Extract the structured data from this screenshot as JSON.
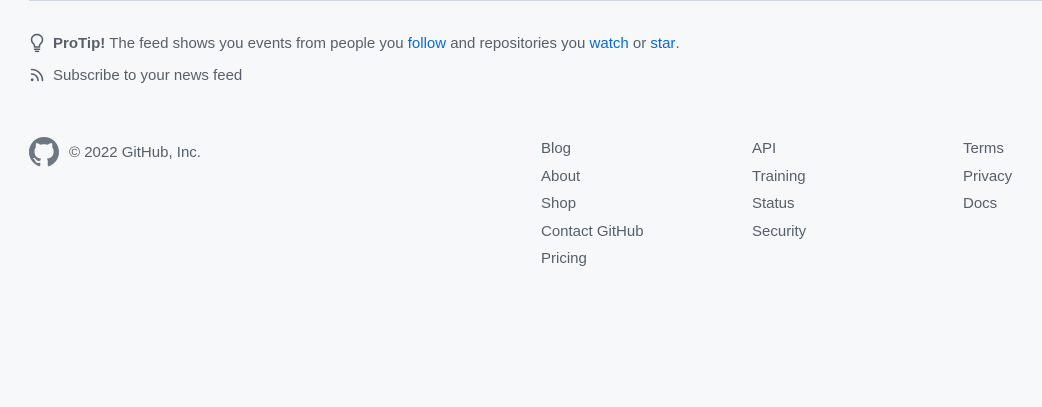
{
  "protip": {
    "label": "ProTip!",
    "text_1": "The feed shows you events from people you",
    "follow": "follow",
    "text_2": "and repositories you",
    "watch": "watch",
    "text_3": "or",
    "star": "star",
    "text_4": "."
  },
  "subscribe": {
    "label": "Subscribe to your news feed"
  },
  "footer": {
    "copyright": "© 2022 GitHub, Inc.",
    "columns": [
      [
        "Blog",
        "About",
        "Shop",
        "Contact GitHub",
        "Pricing"
      ],
      [
        "API",
        "Training",
        "Status",
        "Security"
      ],
      [
        "Terms",
        "Privacy",
        "Docs"
      ]
    ]
  },
  "icons": {
    "protip": "light-bulb-icon",
    "subscribe": "rss-icon",
    "logo": "github-octocat-icon"
  },
  "colors": {
    "background": "#f6f8fa",
    "text": "#57606a",
    "link": "#0969da",
    "rule": "#d0d7de"
  }
}
